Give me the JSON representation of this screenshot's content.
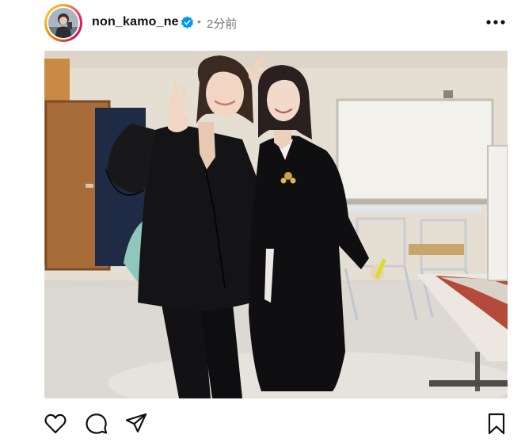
{
  "post": {
    "username": "non_kamo_ne",
    "separator": "•",
    "time_ago": "2分前",
    "verified": true
  },
  "icons": {
    "avatar": "avatar-icon",
    "verified": "verified-badge-icon",
    "more": "more-options-icon",
    "like": "heart-icon",
    "comment": "comment-icon",
    "share": "paper-plane-icon",
    "save": "bookmark-icon"
  },
  "colors": {
    "text_primary": "#111111",
    "text_secondary": "#737373",
    "verified_blue": "#0095f6"
  }
}
